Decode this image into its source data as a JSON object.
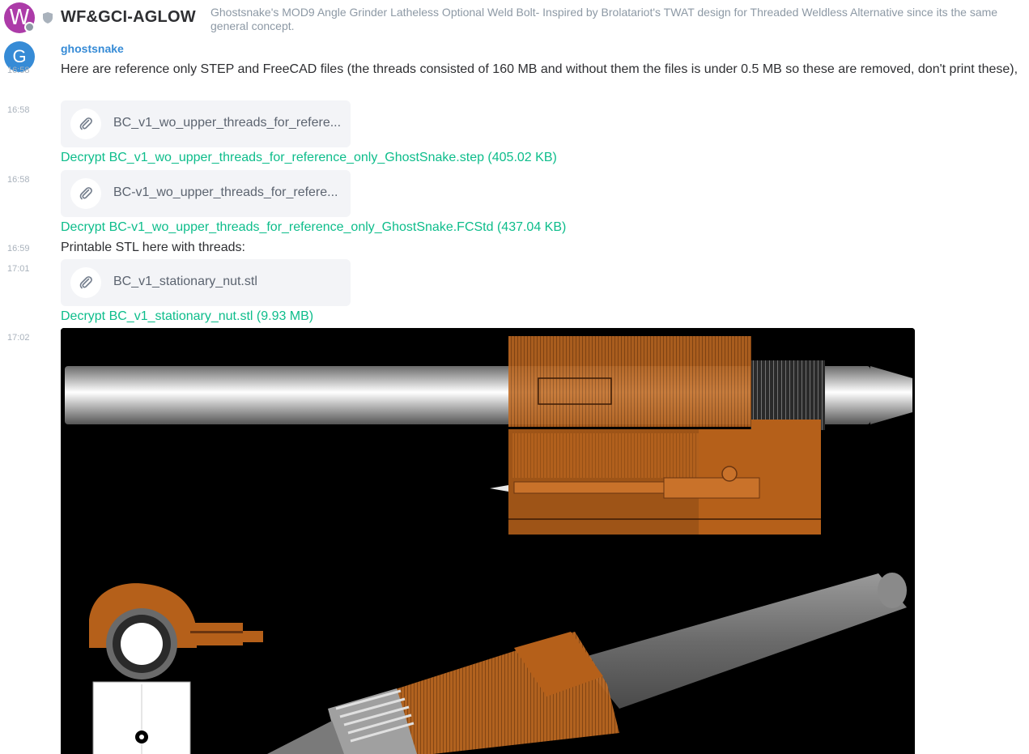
{
  "room": {
    "avatar_letter": "W",
    "name": "WF&GCI-AGLOW",
    "topic": "Ghostsnake's MOD9 Angle Grinder Latheless Optional Weld Bolt- Inspired by Brolatariot's TWAT design for Threaded Weldless Alternative since its the same general concept.",
    "avatar_color": "#ac3ba8"
  },
  "sender": {
    "avatar_letter": "G",
    "name": "ghostsnake",
    "color": "#368bd6"
  },
  "messages": [
    {
      "time": "16:58",
      "text": "Here are reference only STEP and FreeCAD files (the threads consisted of 160 MB and without them the files is under 0.5 MB so these are removed, don't print these),"
    },
    {
      "time": "16:58",
      "file": "BC_v1_wo_upper_threads_for_refere...",
      "decrypt": "Decrypt BC_v1_wo_upper_threads_for_reference_only_GhostSnake.step (405.02 KB)"
    },
    {
      "time": "16:58",
      "file": "BC-v1_wo_upper_threads_for_refere...",
      "decrypt": "Decrypt BC-v1_wo_upper_threads_for_reference_only_GhostSnake.FCStd (437.04 KB)"
    },
    {
      "time": "16:59",
      "text": "Printable STL here with threads:"
    },
    {
      "time": "17:01",
      "file": "BC_v1_stationary_nut.stl",
      "decrypt": "Decrypt BC_v1_stationary_nut.stl (9.93 MB)"
    },
    {
      "time": "17:02",
      "image": "cad-render-image"
    }
  ],
  "colors": {
    "accent_green": "#0dbd8b",
    "orange": "#b5601a"
  },
  "icons": [
    "shield-icon",
    "paperclip-icon"
  ]
}
